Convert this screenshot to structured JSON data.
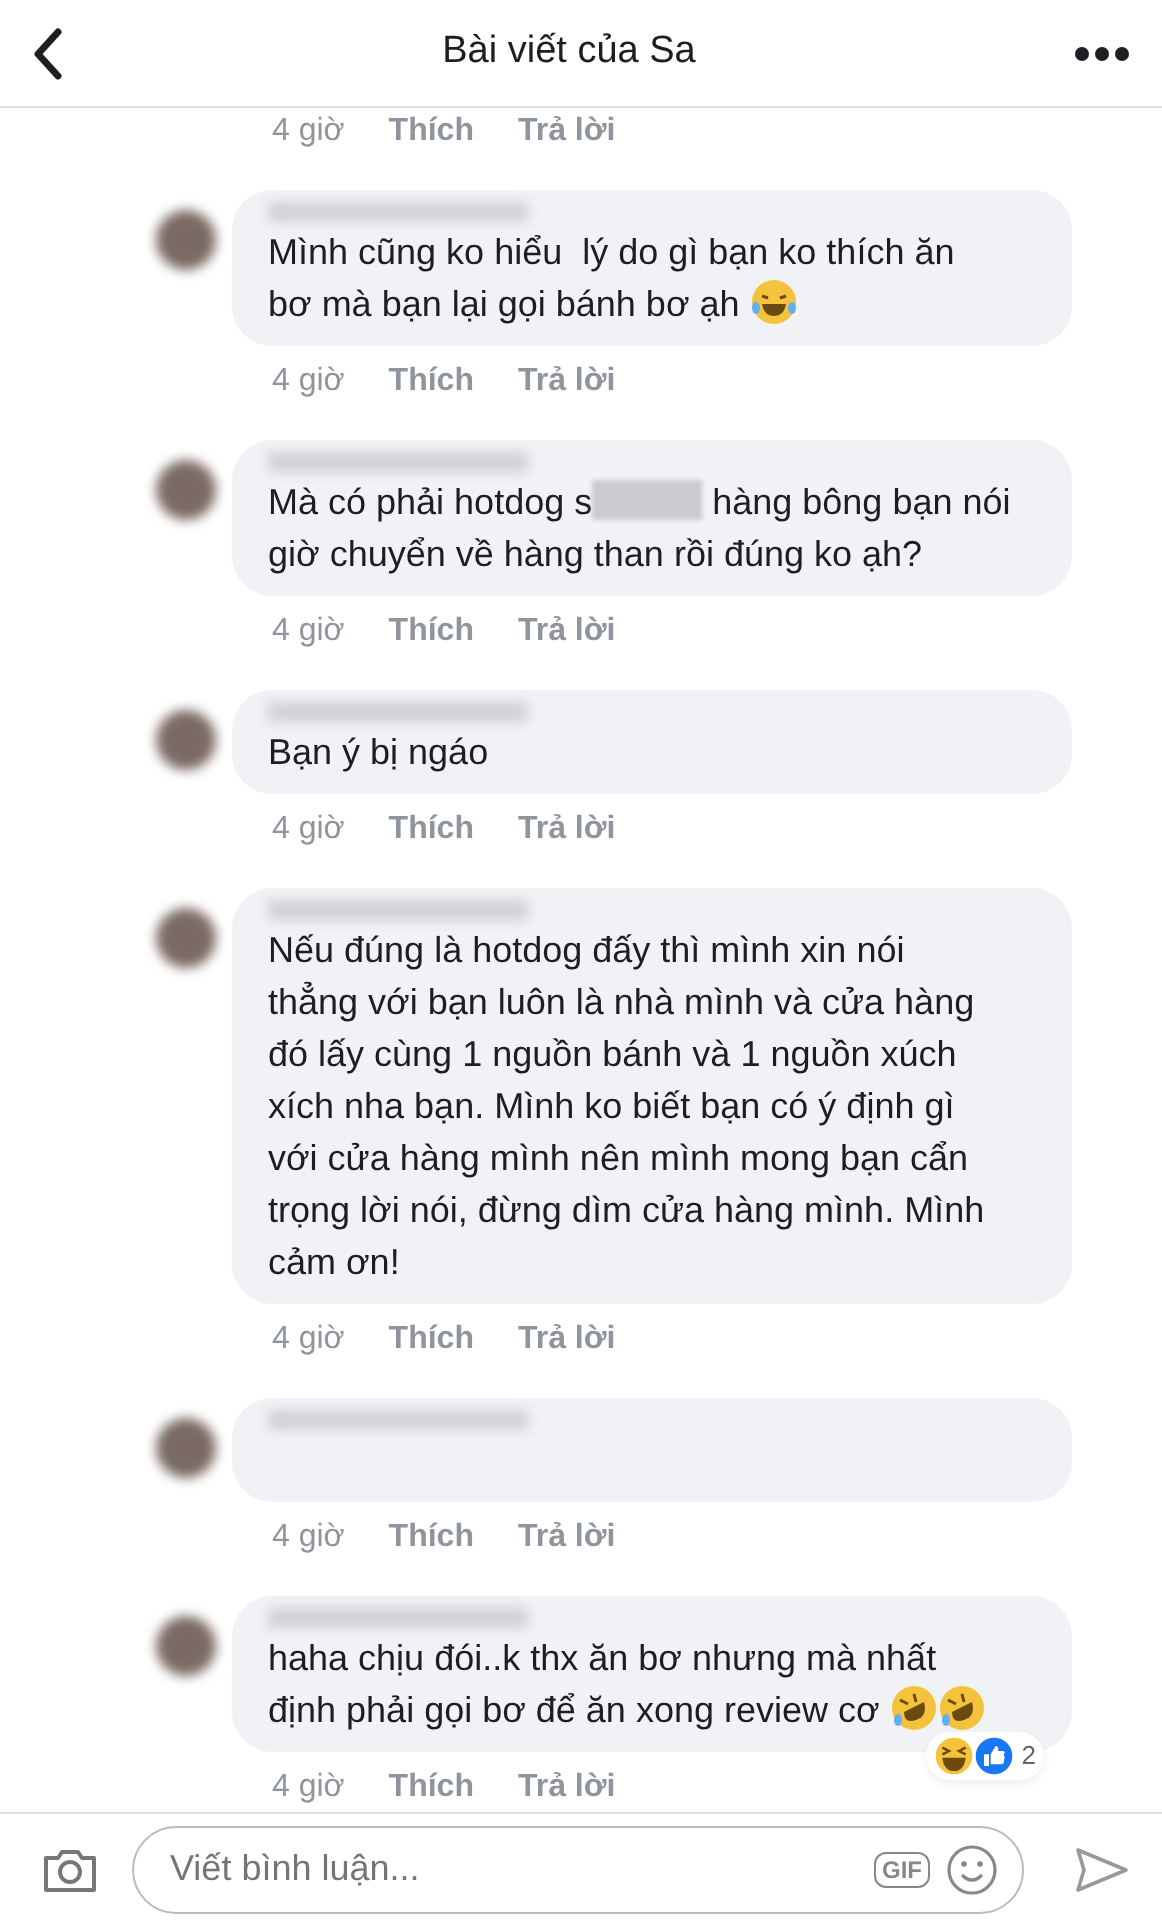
{
  "header": {
    "title": "Bài viết của Sa"
  },
  "top_meta": {
    "time": "4 giờ",
    "like": "Thích",
    "reply": "Trả lời"
  },
  "comments": [
    {
      "lines": [
        [
          {
            "text": "Mình cũng ko hiểu  lý do gì bạn ko thích ăn"
          }
        ],
        [
          {
            "text": "bơ mà bạn lại gọi bánh bơ ạh "
          },
          {
            "kind": "emoji-joy"
          }
        ]
      ],
      "time": "4 giờ",
      "like": "Thích",
      "reply": "Trả lời"
    },
    {
      "lines": [
        [
          {
            "text": "Mà có phải hotdog s"
          },
          {
            "kind": "redaction"
          },
          {
            "text": " hàng bông bạn nói"
          }
        ],
        [
          {
            "text": "giờ chuyển về hàng than rồi đúng ko ạh?"
          }
        ]
      ],
      "time": "4 giờ",
      "like": "Thích",
      "reply": "Trả lời"
    },
    {
      "lines": [
        [
          {
            "text": "Bạn ý bị ngáo"
          }
        ]
      ],
      "time": "4 giờ",
      "like": "Thích",
      "reply": "Trả lời"
    },
    {
      "lines": [
        [
          {
            "text": "Nếu đúng là hotdog đấy thì mình xin nói"
          }
        ],
        [
          {
            "text": "thẳng với bạn luôn là nhà mình và cửa hàng"
          }
        ],
        [
          {
            "text": "đó lấy cùng 1 nguồn bánh và 1 nguồn xúch"
          }
        ],
        [
          {
            "text": "xích nha bạn. Mình ko biết bạn có ý định gì"
          }
        ],
        [
          {
            "text": "với cửa hàng mình nên mình mong bạn cẩn"
          }
        ],
        [
          {
            "text": "trọng lời nói, đừng dìm cửa hàng mình. Mình"
          }
        ],
        [
          {
            "text": "cảm ơn!"
          }
        ]
      ],
      "time": "4 giờ",
      "like": "Thích",
      "reply": "Trả lời"
    },
    {
      "time": "4 giờ",
      "like": "Thích",
      "reply": "Trả lời"
    },
    {
      "lines": [
        [
          {
            "text": "haha chịu đói..k thx ăn bơ nhưng mà nhất"
          }
        ],
        [
          {
            "text": "định phải gọi bơ để ăn xong review cơ "
          },
          {
            "kind": "emoji-rofl"
          },
          {
            "kind": "emoji-rofl"
          }
        ]
      ],
      "time": "4 giờ",
      "like": "Thích",
      "reply": "Trả lời",
      "reactions": {
        "icons": [
          {
            "kind": "haha"
          },
          {
            "kind": "like"
          }
        ],
        "count": "2"
      }
    }
  ],
  "composer": {
    "placeholder": "Viết bình luận...",
    "gif": "GIF"
  }
}
